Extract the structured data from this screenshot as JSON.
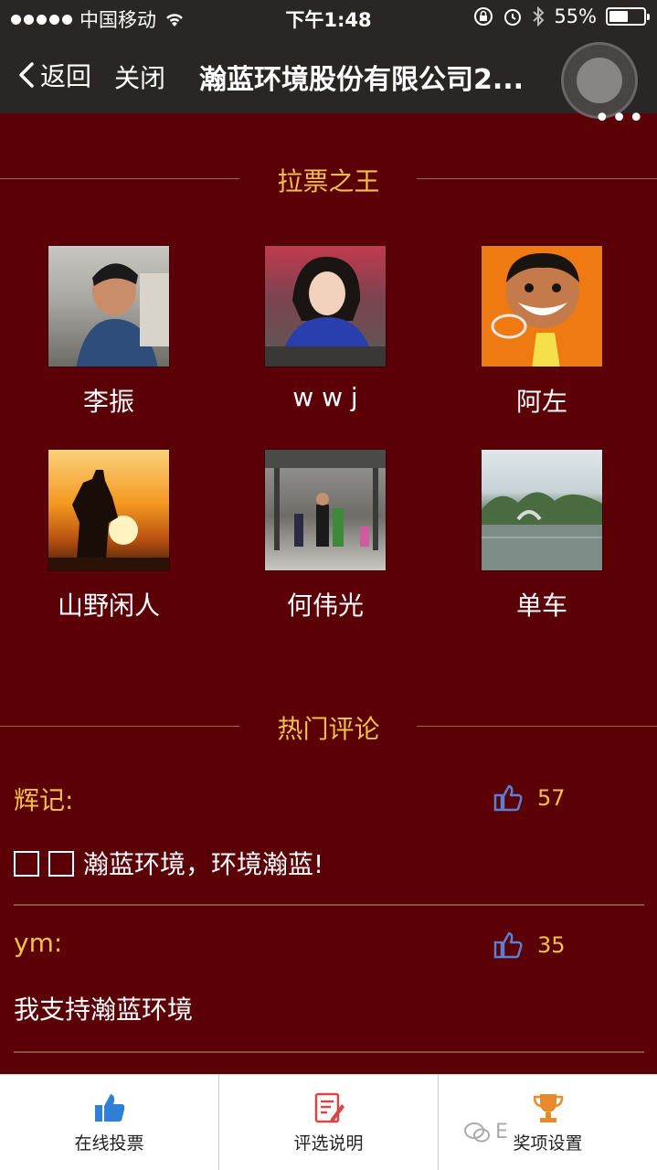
{
  "status_bar": {
    "carrier": "中国移动",
    "time": "下午1:48",
    "battery": "55%",
    "battery_level": 0.55
  },
  "nav": {
    "back_label": "返回",
    "close_label": "关闭",
    "title": "瀚蓝环境股份有限公司2...",
    "more_label": "•••"
  },
  "canvass": {
    "title": "拉票之王",
    "people": [
      {
        "name": "李振",
        "avatar": "person-photo"
      },
      {
        "name": "w w j",
        "avatar": "person-photo"
      },
      {
        "name": "阿左",
        "avatar": "cartoon-photo"
      },
      {
        "name": "山野闲人",
        "avatar": "sunset-silhouette-photo"
      },
      {
        "name": "何伟光",
        "avatar": "group-photo"
      },
      {
        "name": "单车",
        "avatar": "lake-landscape-photo"
      }
    ]
  },
  "hot_comments": {
    "title": "热门评论",
    "items": [
      {
        "author": "辉记:",
        "likes": "57",
        "text": "瀚蓝环境，环境瀚蓝!"
      },
      {
        "author": "ym:",
        "likes": "35",
        "text": "我支持瀚蓝环境"
      }
    ]
  },
  "tabs": [
    {
      "label": "在线投票",
      "icon": "thumbs-up-icon"
    },
    {
      "label": "评选说明",
      "icon": "document-edit-icon"
    },
    {
      "label": "奖项设置",
      "icon": "trophy-icon"
    }
  ],
  "watermark": "E",
  "colors": {
    "background": "#5a0006",
    "accent": "#f2c04a",
    "nav_bg": "#2a2626"
  }
}
